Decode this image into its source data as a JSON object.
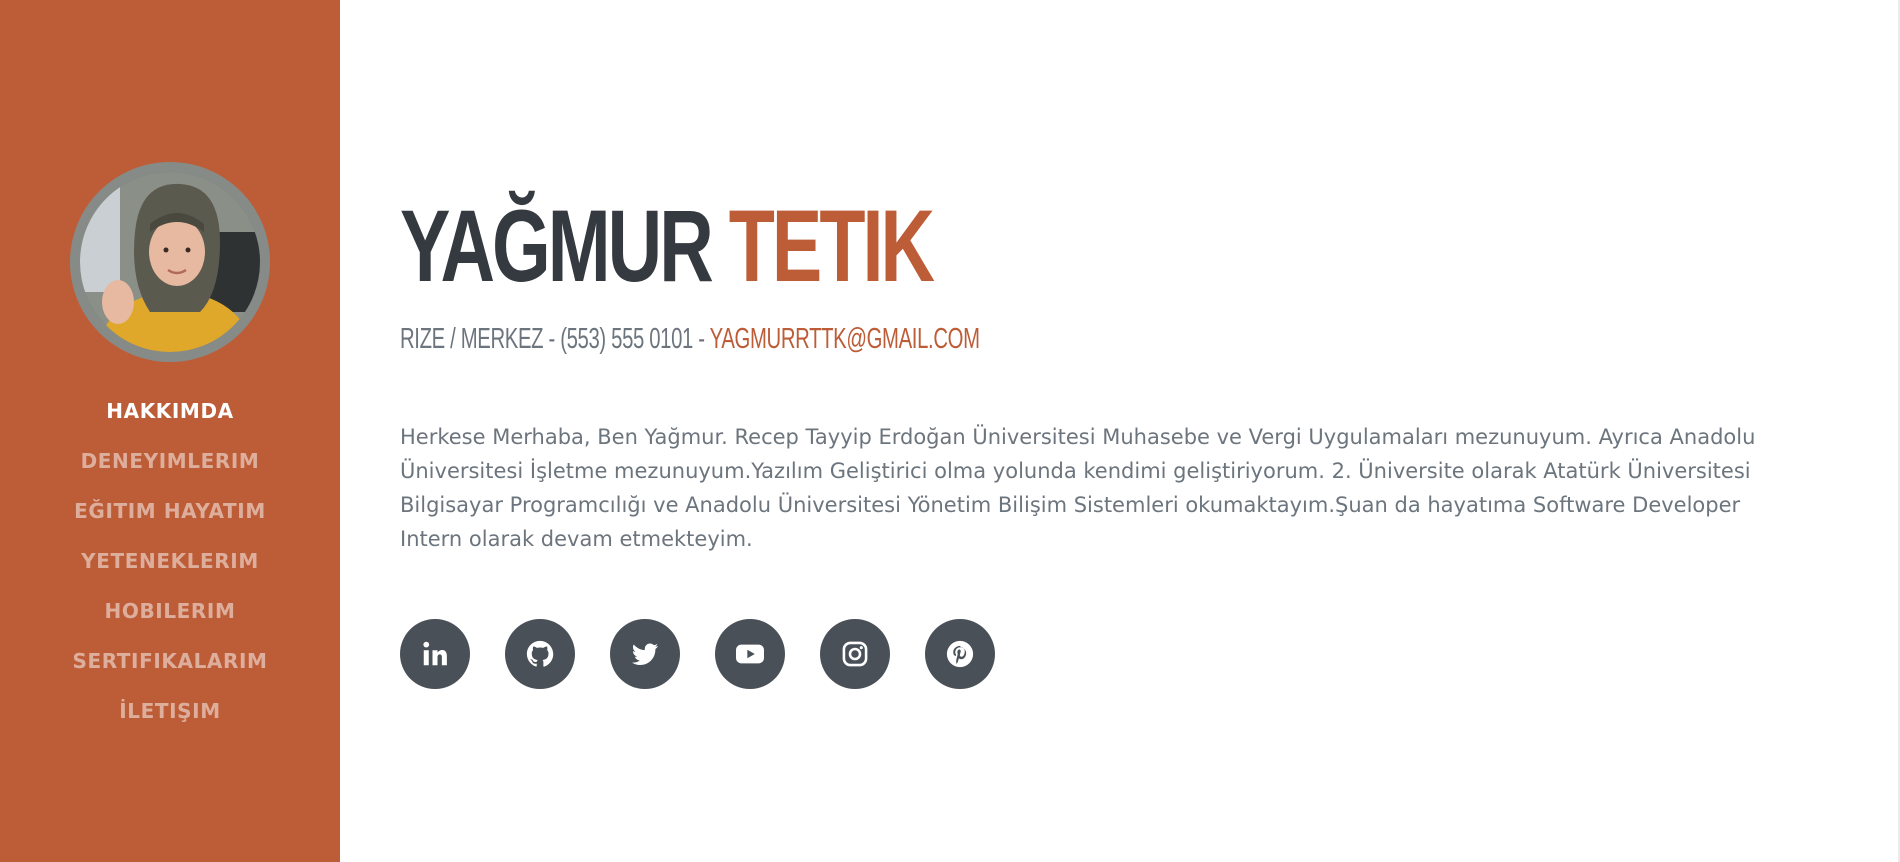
{
  "sidebar": {
    "nav": [
      {
        "label": "HAKKIMDA",
        "active": true
      },
      {
        "label": "DENEYIMLERIM",
        "active": false
      },
      {
        "label": "EĞITIM HAYATIM",
        "active": false
      },
      {
        "label": "YETENEKLERIM",
        "active": false
      },
      {
        "label": "HOBILERIM",
        "active": false
      },
      {
        "label": "SERTIFIKALARIM",
        "active": false
      },
      {
        "label": "İLETIŞIM",
        "active": false
      }
    ]
  },
  "profile": {
    "first_name": "YAĞMUR",
    "last_name": "TETIK",
    "location": "RIZE / MERKEZ",
    "separator": " - ",
    "phone": "(553) 555 0101",
    "email": "YAGMURRTTK@GMAIL.COM",
    "about": "Herkese Merhaba, Ben Yağmur. Recep Tayyip Erdoğan Üniversitesi Muhasebe ve Vergi Uygulamaları mezunuyum. Ayrıca Anadolu Üniversitesi İşletme mezunuyum.Yazılım Geliştirici olma yolunda kendimi geliştiriyorum. 2. Üniversite olarak Atatürk Üniversitesi Bilgisayar Programcılığı ve Anadolu Üniversitesi Yönetim Bilişim Sistemleri okumaktayım.Şuan da hayatıma Software Developer Intern olarak devam etmekteyim."
  },
  "social": [
    {
      "icon": "linkedin-icon"
    },
    {
      "icon": "github-icon"
    },
    {
      "icon": "twitter-icon"
    },
    {
      "icon": "youtube-icon"
    },
    {
      "icon": "instagram-icon"
    },
    {
      "icon": "pinterest-icon"
    }
  ],
  "colors": {
    "primary": "#bd5d38",
    "dark": "#343a40",
    "muted": "#6c757d",
    "social_bg": "#495057"
  }
}
